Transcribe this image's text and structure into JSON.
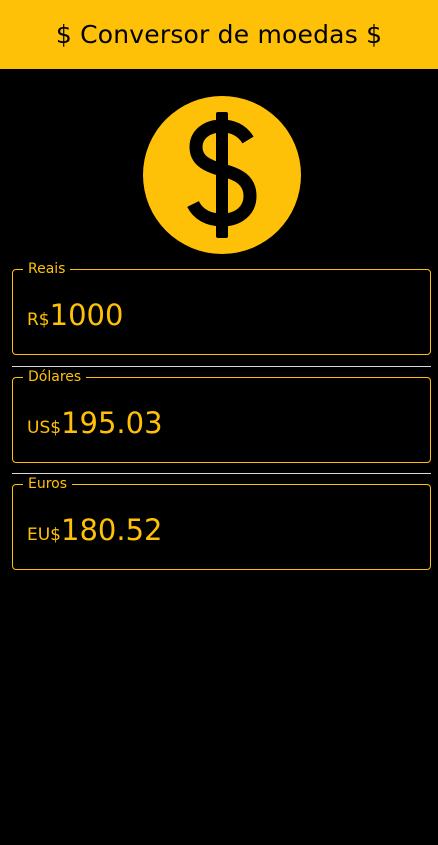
{
  "appbar": {
    "title": "$ Conversor de moedas $"
  },
  "colors": {
    "accent": "#FFC107",
    "background": "#000000",
    "divider": "#D8D8D8"
  },
  "logo": {
    "icon": "dollar-coin-icon"
  },
  "fields": {
    "reais": {
      "label": "Reais",
      "prefix": "R$",
      "value": "1000"
    },
    "dolares": {
      "label": "Dólares",
      "prefix": "US$",
      "value": "195.03"
    },
    "euros": {
      "label": "Euros",
      "prefix": "EU$",
      "value": "180.52"
    }
  }
}
